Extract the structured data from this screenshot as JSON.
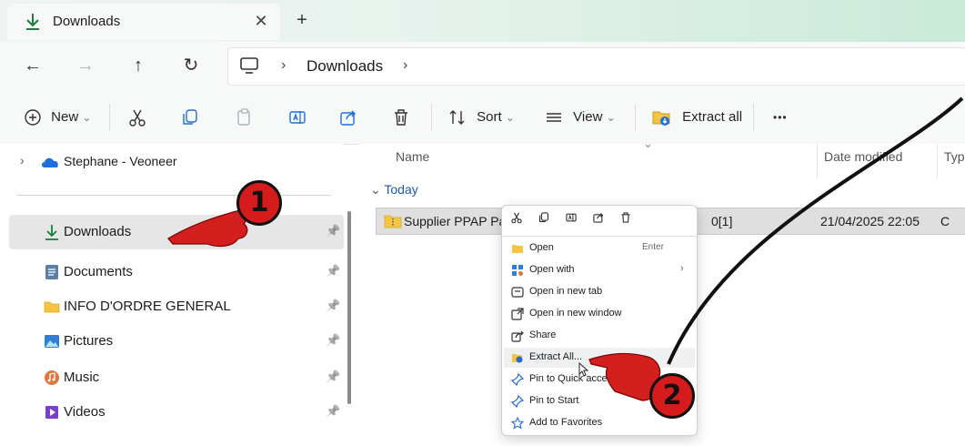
{
  "window": {
    "tab_title": "Downloads",
    "tab_close_glyph": "✕",
    "new_tab_glyph": "+"
  },
  "nav": {
    "back_glyph": "←",
    "forward_glyph": "→",
    "up_glyph": "↑",
    "refresh_glyph": "↻"
  },
  "address": {
    "sep_glyph": "›",
    "path": "Downloads"
  },
  "toolbar": {
    "new_label": "New",
    "sort_label": "Sort",
    "view_label": "View",
    "extract_all_label": "Extract all",
    "more_glyph": "•••",
    "chevron_glyph": "⌄"
  },
  "sidebar": {
    "onedrive_label": "Stephane - Veoneer",
    "expand_glyph": "›",
    "pin_glyph": "📌",
    "items": [
      {
        "label": "Downloads",
        "icon": "download-icon"
      },
      {
        "label": "Documents",
        "icon": "documents-icon"
      },
      {
        "label": "INFO D'ORDRE GENERAL",
        "icon": "folder-icon"
      },
      {
        "label": "Pictures",
        "icon": "pictures-icon"
      },
      {
        "label": "Music",
        "icon": "music-icon"
      },
      {
        "label": "Videos",
        "icon": "videos-icon"
      }
    ]
  },
  "content": {
    "columns": {
      "name": "Name",
      "date_modified": "Date modified",
      "type": "Typ"
    },
    "group": "Today",
    "group_glyph": "⌄",
    "file": {
      "name": "Supplier PPAP Pa",
      "name_suffix": "0[1]",
      "date": "21/04/2025 22:05",
      "type_trunc": "C"
    }
  },
  "context_menu": {
    "items": [
      {
        "label": "Open",
        "shortcut": "Enter",
        "icon": "folder-open-icon"
      },
      {
        "label": "Open with",
        "icon": "open-with-icon",
        "submenu_glyph": "›"
      },
      {
        "label": "Open in new tab",
        "icon": "new-tab-icon"
      },
      {
        "label": "Open in new window",
        "icon": "new-window-icon"
      },
      {
        "label": "Share",
        "icon": "share-icon"
      },
      {
        "label": "Extract All...",
        "icon": "extract-icon"
      },
      {
        "label": "Pin to Quick access",
        "icon": "pin-icon"
      },
      {
        "label": "Pin to Start",
        "icon": "pin-icon"
      },
      {
        "label": "Add to Favorites",
        "icon": "star-icon"
      }
    ]
  },
  "annotations": {
    "step1": "1",
    "step2": "2"
  },
  "colors": {
    "accent_green": "#188038",
    "badge_red": "#d51b1b",
    "folder_yellow": "#f5c542"
  }
}
